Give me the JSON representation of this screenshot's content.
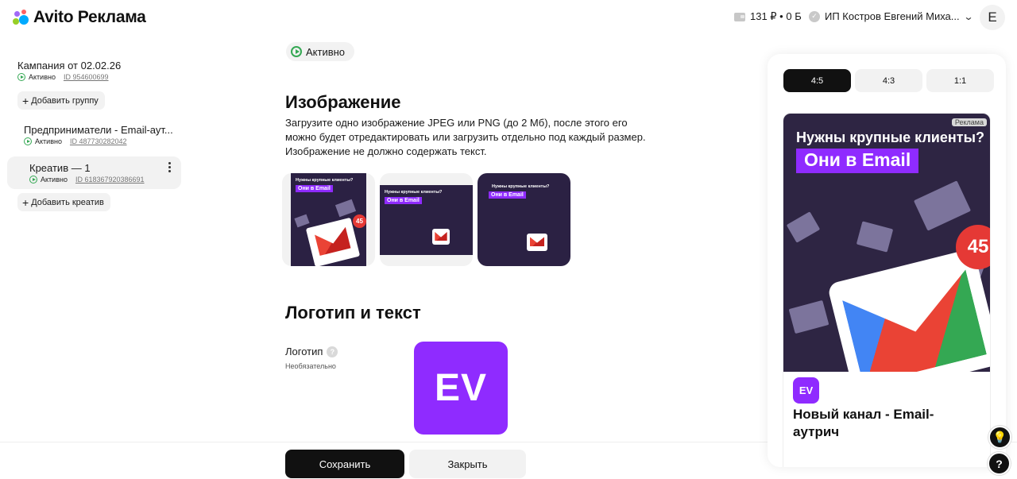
{
  "header": {
    "logo_text": "Avito Реклама",
    "balance": "131 ₽ • 0 Б",
    "account_name": "ИП Костров Евгений Миха...",
    "avatar_letter": "Е"
  },
  "sidebar": {
    "campaign": {
      "title": "Кампания от 02.02.26",
      "status": "Активно",
      "id": "ID 954600699"
    },
    "add_group_label": "Добавить группу",
    "group": {
      "title": "Предприниматели - Email-аут...",
      "status": "Активно",
      "id": "ID 487730282042"
    },
    "creative": {
      "title": "Креатив — 1",
      "status": "Активно",
      "id": "ID 618367920386691"
    },
    "add_creative_label": "Добавить креатив"
  },
  "main": {
    "status_label": "Активно",
    "image_section": {
      "title": "Изображение",
      "description": "Загрузите одно изображение JPEG или PNG (до 2 Мб), после этого его можно будет отредактировать или загрузить отдельно под каждый размер. Изображение не должно содержать текст.",
      "thumbs": [
        {
          "ratio": "4:5",
          "header": "Нужны крупные клиенты?",
          "tag": "Они в Email",
          "badge": "45"
        },
        {
          "ratio": "4:3",
          "header": "Нужны крупные клиенты?",
          "tag": "Они в Email"
        },
        {
          "ratio": "1:1",
          "header": "Нужны крупные клиенты?",
          "tag": "Они в Email"
        }
      ]
    },
    "logo_section": {
      "title": "Логотип и текст",
      "logo_label": "Логотип",
      "logo_hint": "Необязательно",
      "logo_mark": "EV"
    }
  },
  "footer": {
    "save_label": "Сохранить",
    "close_label": "Закрыть"
  },
  "preview": {
    "tabs": [
      "4:5",
      "4:3",
      "1:1"
    ],
    "active_tab": "4:5",
    "ad_label": "Реклама",
    "ad_header": "Нужны крупные клиенты?",
    "ad_tag": "Они в Email",
    "ad_badge": "45",
    "logo_mark": "EV",
    "ad_title": "Новый канал - Email-аутрич"
  },
  "float_buttons": {
    "lightbulb": "💡",
    "help": "?"
  },
  "colors": {
    "accent_purple": "#8f2bff",
    "status_green": "#34a853",
    "primary_button": "#111111"
  }
}
